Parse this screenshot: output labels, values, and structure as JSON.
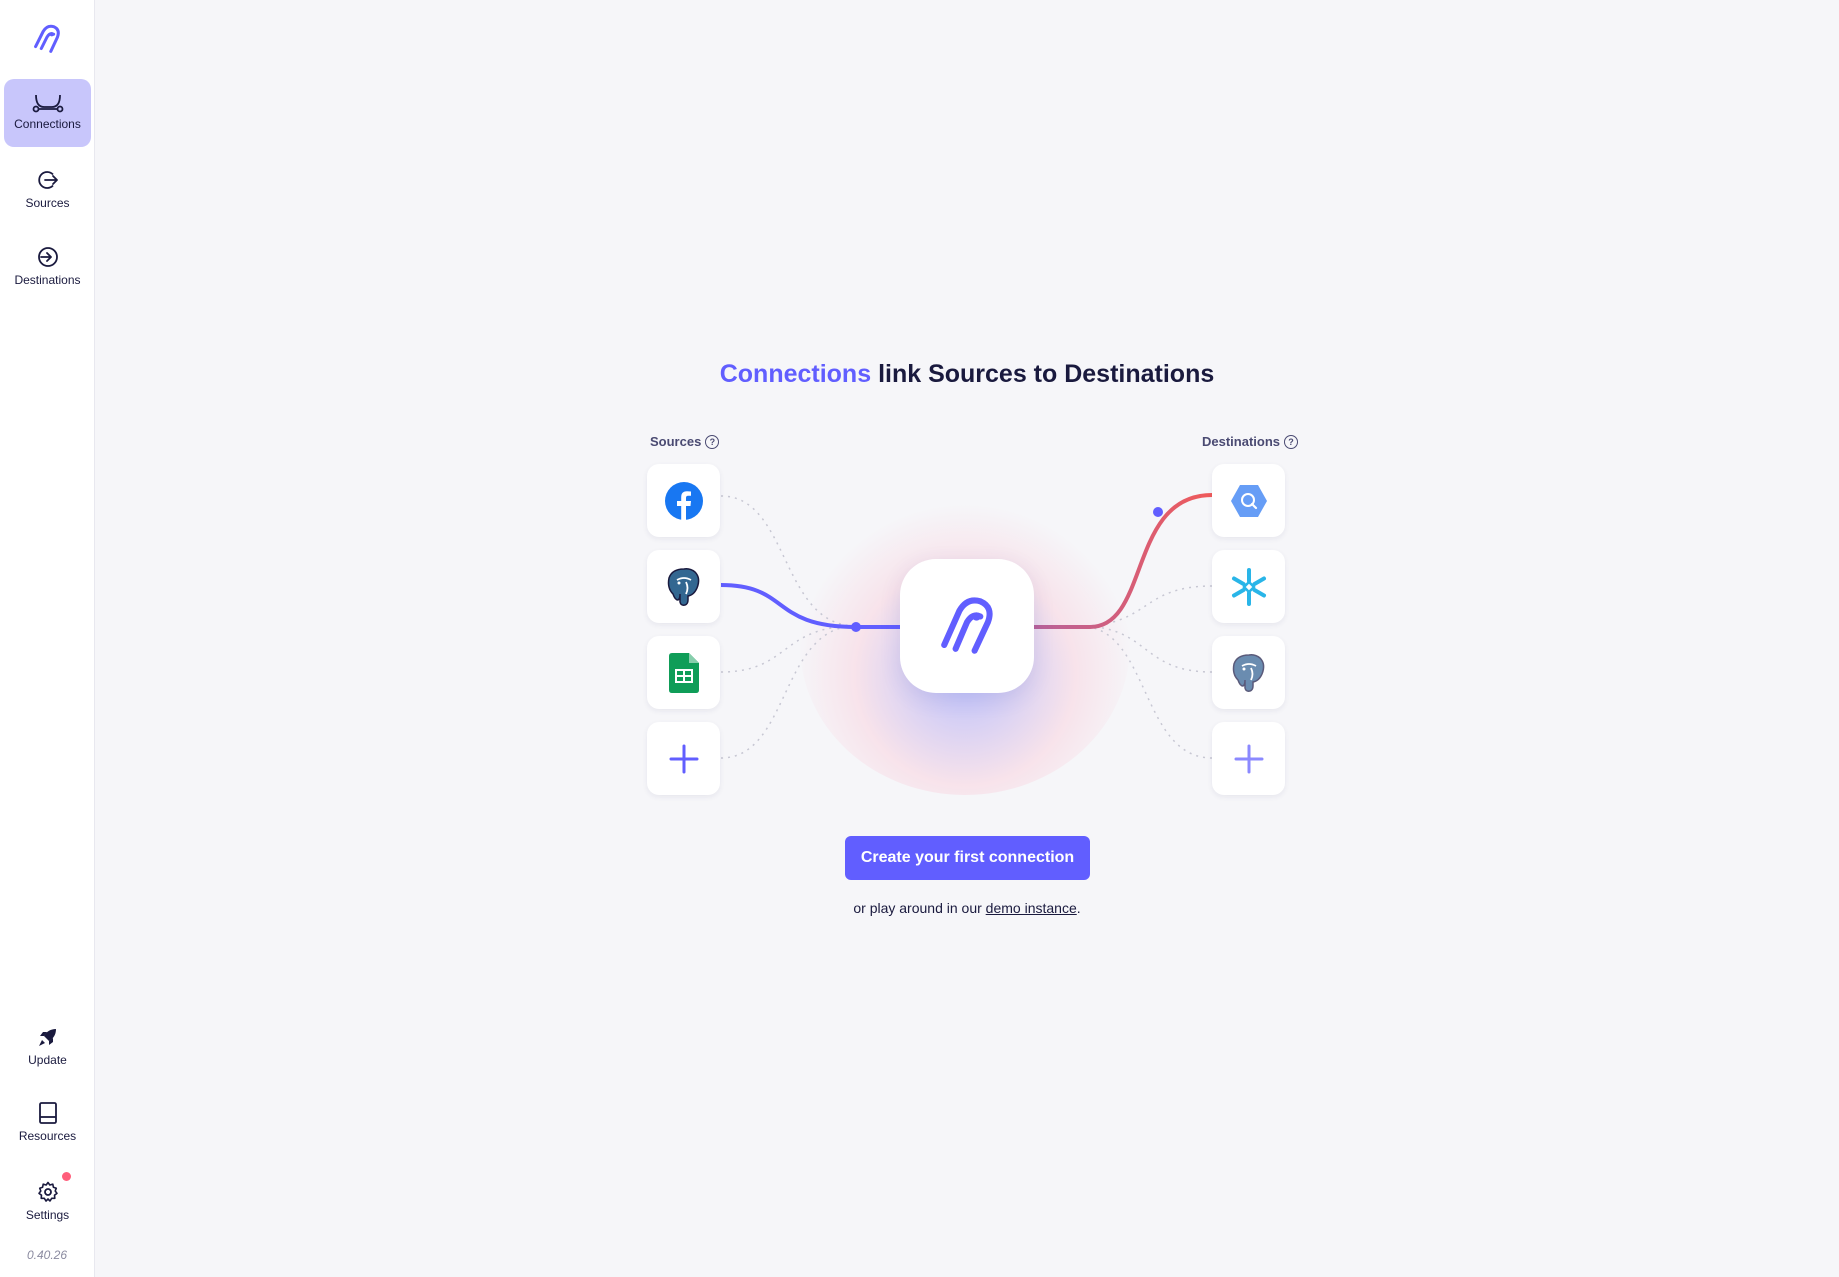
{
  "sidebar": {
    "logo_icon": "airbyte-logo",
    "items": [
      {
        "label": "Connections",
        "icon": "connections-icon",
        "active": true
      },
      {
        "label": "Sources",
        "icon": "sources-icon"
      },
      {
        "label": "Destinations",
        "icon": "destinations-icon"
      }
    ],
    "bottom_items": [
      {
        "label": "Update",
        "icon": "rocket-icon"
      },
      {
        "label": "Resources",
        "icon": "book-icon"
      },
      {
        "label": "Settings",
        "icon": "gear-icon",
        "has_notification": true
      }
    ],
    "version": "0.40.26"
  },
  "main": {
    "heading_accent": "Connections",
    "heading_rest": " link Sources to Destinations",
    "sources_label": "Sources",
    "destinations_label": "Destinations",
    "sources": [
      "facebook-icon",
      "postgres-icon",
      "google-sheets-icon",
      "plus-icon"
    ],
    "destinations": [
      "bigquery-icon",
      "snowflake-icon",
      "postgres-icon",
      "plus-icon"
    ],
    "cta_label": "Create your first connection",
    "subtext_before": "or play around in our ",
    "subtext_link": "demo instance",
    "subtext_after": "."
  },
  "colors": {
    "accent": "#615eff",
    "active_nav": "#c8c6fb",
    "destination_line": "#f05a5a"
  }
}
